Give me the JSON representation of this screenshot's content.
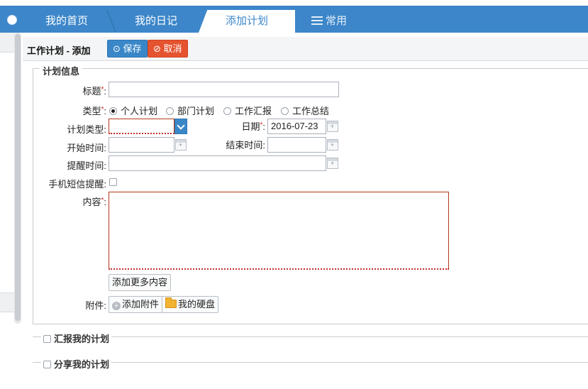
{
  "tabs": [
    {
      "label": "我的首页",
      "active": false
    },
    {
      "label": "我的日记",
      "active": false
    },
    {
      "label": "添加计划",
      "active": true
    },
    {
      "label": "常用",
      "active": false,
      "icon": "menu-icon"
    }
  ],
  "toolbar": {
    "title": "工作计划 - 添加",
    "save_label": "⊙ 保存",
    "cancel_label": "⊘ 取消"
  },
  "form": {
    "legend": "计划信息",
    "title_label": "标题",
    "type_label": "类型",
    "type_options": [
      "个人计划",
      "部门计划",
      "工作汇报",
      "工作总结"
    ],
    "type_selected": "个人计划",
    "plan_type_label": "计划类型:",
    "date_label": "日期",
    "date_value": "2016-07-23",
    "start_label": "开始时间:",
    "end_label": "结束时间:",
    "remind_label": "提醒时间:",
    "sms_label": "手机短信提醒:",
    "content_label": "内容",
    "add_more_label": "添加更多内容",
    "attach_label": "附件:",
    "add_attach_label": "添加附件",
    "my_disk_label": "我的硬盘"
  },
  "sections": {
    "report": "汇报我的计划",
    "share": "分享我的计划"
  },
  "colors": {
    "accent": "#3c86c9",
    "danger": "#e5532f",
    "required": "#e02020"
  }
}
